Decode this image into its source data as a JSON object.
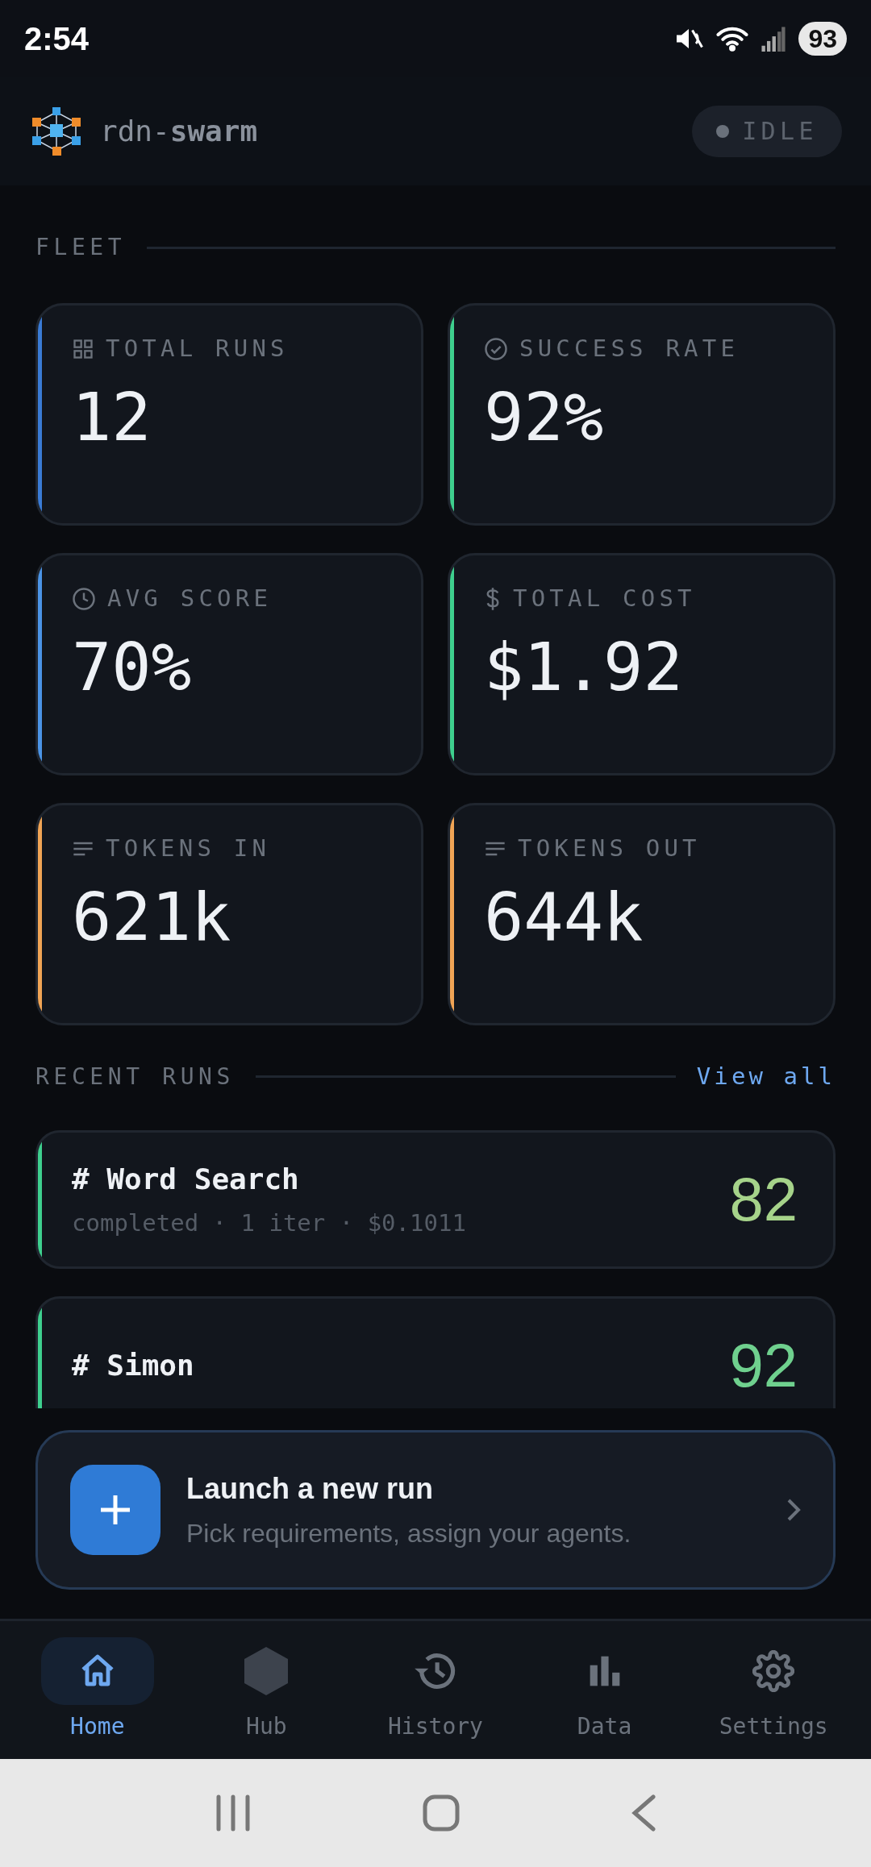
{
  "status_bar": {
    "time": "2:54",
    "battery": "93"
  },
  "header": {
    "brand": "rdn-**swarm**",
    "status": "IDLE"
  },
  "fleet": {
    "title": "FLEET",
    "stats": [
      {
        "label": "TOTAL RUNS",
        "value": "12",
        "color": "#3a7bd5"
      },
      {
        "label": "SUCCESS RATE",
        "value": "92%",
        "color": "#3ecf8e"
      },
      {
        "label": "AVG SCORE",
        "value": "70%",
        "color": "#4b94e6"
      },
      {
        "label": "TOTAL COST",
        "value": "$1.92",
        "color": "#3ecf8e"
      },
      {
        "label": "TOKENS IN",
        "value": "621k",
        "color": "#f0a455"
      },
      {
        "label": "TOKENS OUT",
        "value": "644k",
        "color": "#f0a455"
      }
    ]
  },
  "recent_runs": {
    "title": "RECENT RUNS",
    "link": "View all",
    "runs": [
      {
        "title": "# Word Search",
        "meta": "completed · 1 iter · $0.1011",
        "score": "82",
        "color": "#a6d38a"
      },
      {
        "title": "# Simon",
        "score": "92",
        "color": "#6fd08e"
      }
    ]
  },
  "launch": {
    "title": "Launch a new run",
    "subtitle": "Pick requirements, assign your agents."
  },
  "nav": [
    {
      "label": "Home",
      "selected": true
    },
    {
      "label": "Hub",
      "selected": false
    },
    {
      "label": "History",
      "selected": false
    },
    {
      "label": "Data",
      "selected": false
    },
    {
      "label": "Settings",
      "selected": false
    }
  ]
}
